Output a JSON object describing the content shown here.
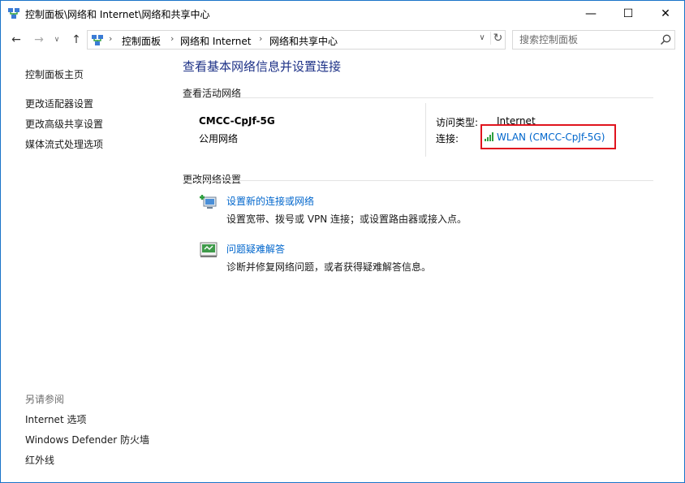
{
  "window": {
    "title": "控制面板\\网络和 Internet\\网络和共享中心",
    "minimize_glyph": "—",
    "maximize_glyph": "☐",
    "close_glyph": "✕"
  },
  "nav": {
    "back_glyph": "←",
    "forward_glyph": "→",
    "recent_glyph": "∨",
    "up_glyph": "↑",
    "breadcrumb": [
      "控制面板",
      "网络和 Internet",
      "网络和共享中心"
    ],
    "separator": "›",
    "dropdown_glyph": "∨",
    "refresh_glyph": "↻",
    "search_placeholder": "搜索控制面板"
  },
  "sidebar": {
    "home": "控制面板主页",
    "links": [
      "更改适配器设置",
      "更改高级共享设置",
      "媒体流式处理选项"
    ],
    "see_also_heading": "另请参阅",
    "see_also": [
      "Internet 选项",
      "Windows Defender 防火墙",
      "红外线"
    ]
  },
  "main": {
    "title": "查看基本网络信息并设置连接",
    "active_networks_label": "查看活动网络",
    "network": {
      "name": "CMCC-CpJf-5G",
      "category": "公用网络",
      "access_type_label": "访问类型:",
      "access_type_value": "Internet",
      "connection_label": "连接:",
      "connection_value": "WLAN (CMCC-CpJf-5G)"
    },
    "change_settings_label": "更改网络设置",
    "tasks": [
      {
        "link": "设置新的连接或网络",
        "desc": "设置宽带、拨号或 VPN 连接；或设置路由器或接入点。"
      },
      {
        "link": "问题疑难解答",
        "desc": "诊断并修复网络问题，或者获得疑难解答信息。"
      }
    ]
  },
  "colors": {
    "title_blue": "#1e3287",
    "link_blue": "#0066cc",
    "highlight_red": "#e0141e",
    "window_border": "#1a73c8"
  },
  "icons": {
    "window": "network-center-icon",
    "search": "search-icon",
    "wifi": "wifi-signal-icon",
    "new_connection": "new-connection-icon",
    "troubleshoot": "troubleshoot-icon"
  }
}
